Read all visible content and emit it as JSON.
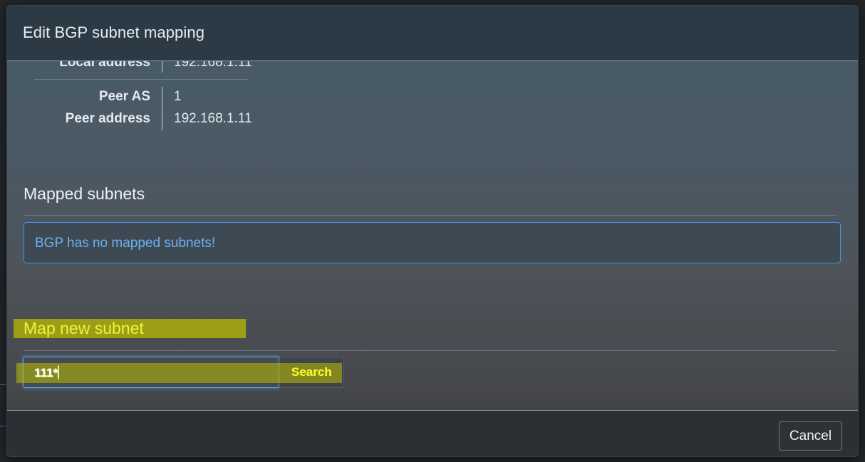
{
  "modal": {
    "title": "Edit BGP subnet mapping"
  },
  "bgp_info": {
    "local_address_label": "Local address",
    "local_address_value": "192.168.1.11",
    "peer_as_label": "Peer AS",
    "peer_as_value": "1",
    "peer_address_label": "Peer address",
    "peer_address_value": "192.168.1.11"
  },
  "mapped_subnets": {
    "title": "Mapped subnets",
    "empty_message": "BGP has no mapped subnets!"
  },
  "map_new_subnet": {
    "title": "Map new subnet",
    "search_input_value": "111*",
    "search_button_label": "Search"
  },
  "footer": {
    "cancel_label": "Cancel"
  },
  "colors": {
    "highlight": "#bebe00",
    "alert_text": "#6db0f2",
    "alert_border": "#4a94e0",
    "header_bg": "#2b3a44",
    "footer_bg": "#2c2f33"
  }
}
